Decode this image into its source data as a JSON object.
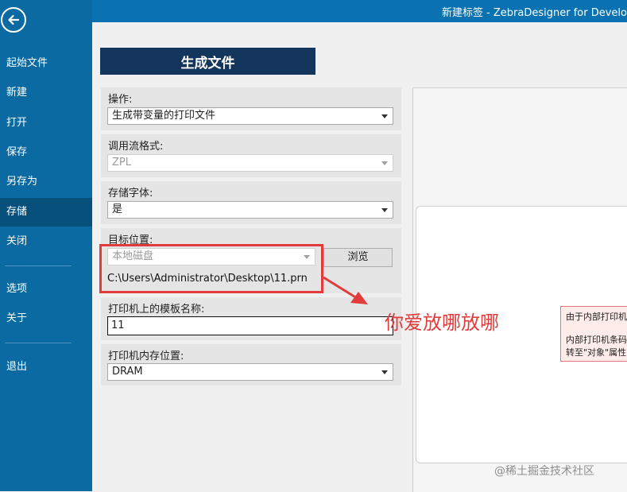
{
  "window": {
    "title": "新建标签 - ZebraDesigner for Develo"
  },
  "sidebar": {
    "items": [
      {
        "label": "起始文件"
      },
      {
        "label": "新建"
      },
      {
        "label": "打开"
      },
      {
        "label": "保存"
      },
      {
        "label": "另存为"
      },
      {
        "label": "存储"
      },
      {
        "label": "关闭"
      },
      {
        "label": "选项"
      },
      {
        "label": "关于"
      },
      {
        "label": "退出"
      }
    ],
    "active": "存储"
  },
  "page": {
    "heading": "生成文件"
  },
  "form": {
    "operation": {
      "label": "操作:",
      "value": "生成带变量的打印文件"
    },
    "stream_format": {
      "label": "调用流格式:",
      "value": "ZPL"
    },
    "store_fonts": {
      "label": "存储字体:",
      "value": "是"
    },
    "target": {
      "label": "目标位置:",
      "value": "本地磁盘",
      "browse_label": "浏览",
      "path": "C:\\Users\\Administrator\\Desktop\\11.prn"
    },
    "template_name": {
      "label": "打印机上的模板名称:",
      "value": "11"
    },
    "memory_location": {
      "label": "打印机内存位置:",
      "value": "DRAM"
    }
  },
  "annotation": {
    "text": "你爱放哪放哪",
    "color": "#e23b3b"
  },
  "preview": {
    "warning_lines": [
      "由于内部打印机",
      "",
      "内部打印机条码",
      "转至\"对象\"属性"
    ]
  },
  "watermark": "@稀土掘金技术社区",
  "colors": {
    "sidebar": "#0b6aa2",
    "active": "#07507c",
    "heading": "#14355c",
    "accent": "#e23b3b"
  }
}
